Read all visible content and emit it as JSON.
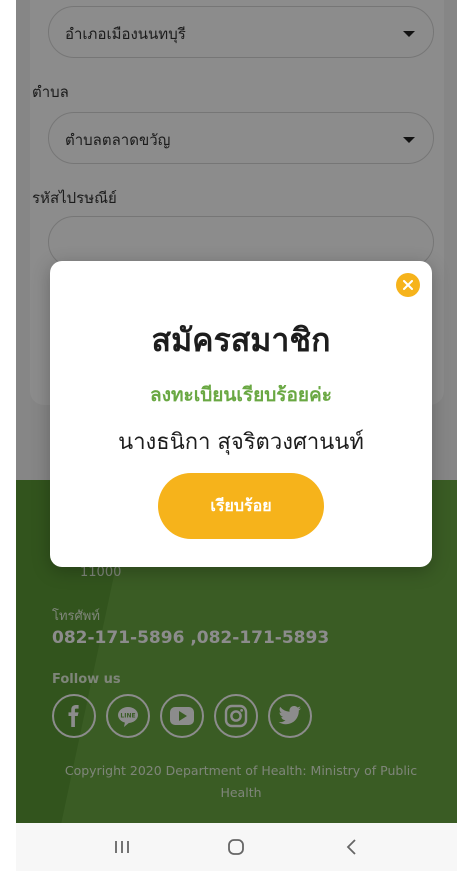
{
  "form": {
    "district_value": "อำเภอเมืองนนทบุรี",
    "subdistrict_label": "ตำบล",
    "subdistrict_value": "ตำบลตลาดขวัญ",
    "postal_label": "รหัสไปรษณีย์",
    "postal_value": ""
  },
  "footer": {
    "postal_code": "11000",
    "phone_label": "โทรศัพท์",
    "phone_numbers": "082-171-5896 ,082-171-5893",
    "follow_label": "Follow us",
    "socials": [
      "facebook-icon",
      "line-icon",
      "youtube-icon",
      "instagram-icon",
      "twitter-icon"
    ],
    "copyright": "Copyright 2020 Department of Health: Ministry of Public Health"
  },
  "modal": {
    "title": "สมัครสมาชิก",
    "subtitle": "ลงทะเบียนเรียบร้อยค่ะ",
    "member_name": "นางธนิกา สุจริตวงศานนท์",
    "confirm_label": "เรียบร้อย"
  },
  "colors": {
    "accent_yellow": "#f6b31b",
    "brand_green": "#6aa843",
    "overlay": "rgba(0,0,0,0.45)"
  },
  "navbar": {
    "buttons": [
      "recent-apps-icon",
      "home-icon",
      "back-icon"
    ]
  }
}
